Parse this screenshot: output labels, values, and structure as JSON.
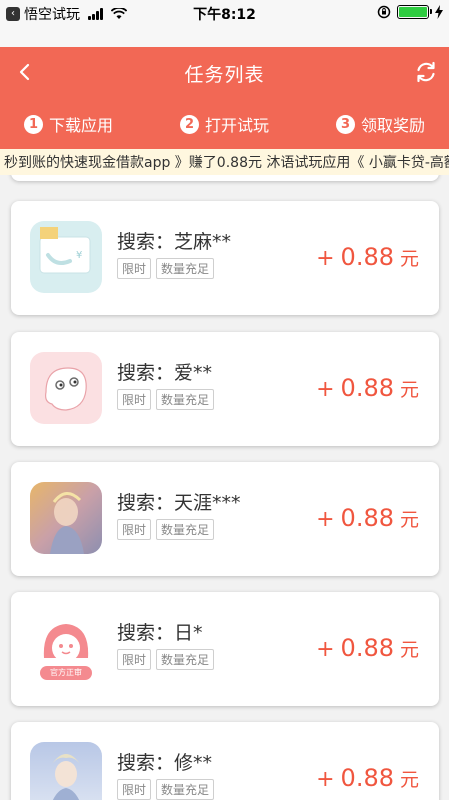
{
  "status_bar": {
    "back_label": "悟空试玩",
    "time": "下午8:12",
    "battery_level_pct": 100
  },
  "header": {
    "title": "任务列表",
    "steps": [
      {
        "num": "1",
        "label": "下载应用"
      },
      {
        "num": "2",
        "label": "打开试玩"
      },
      {
        "num": "3",
        "label": "领取奖励"
      }
    ]
  },
  "ticker": {
    "text": "秒到账的快速现金借款app 》赚了0.88元    沐语试玩应用《 小赢卡贷-高额"
  },
  "tasks": [
    {
      "title": "搜索：芝麻**",
      "tags": [
        "限时",
        "数量充足"
      ],
      "plus": "+",
      "amount": "0.88",
      "unit": "元",
      "icon": "wallet-card-icon"
    },
    {
      "title": "搜索：爱**",
      "tags": [
        "限时",
        "数量充足"
      ],
      "plus": "+",
      "amount": "0.88",
      "unit": "元",
      "icon": "cute-face-icon"
    },
    {
      "title": "搜索：天涯***",
      "tags": [
        "限时",
        "数量充足"
      ],
      "plus": "+",
      "amount": "0.88",
      "unit": "元",
      "icon": "warrior-game-icon"
    },
    {
      "title": "搜索：日*",
      "tags": [
        "限时",
        "数量充足"
      ],
      "plus": "+",
      "amount": "0.88",
      "unit": "元",
      "icon": "pink-mascot-icon",
      "icon_caption": "官方正审"
    },
    {
      "title": "搜索：修**",
      "tags": [
        "限时",
        "数量充足"
      ],
      "plus": "+",
      "amount": "0.88",
      "unit": "元",
      "icon": "fantasy-hero-icon"
    }
  ],
  "colors": {
    "brand": "#f26855",
    "reward": "#f0563f",
    "ticker_bg": "#fff7df"
  }
}
